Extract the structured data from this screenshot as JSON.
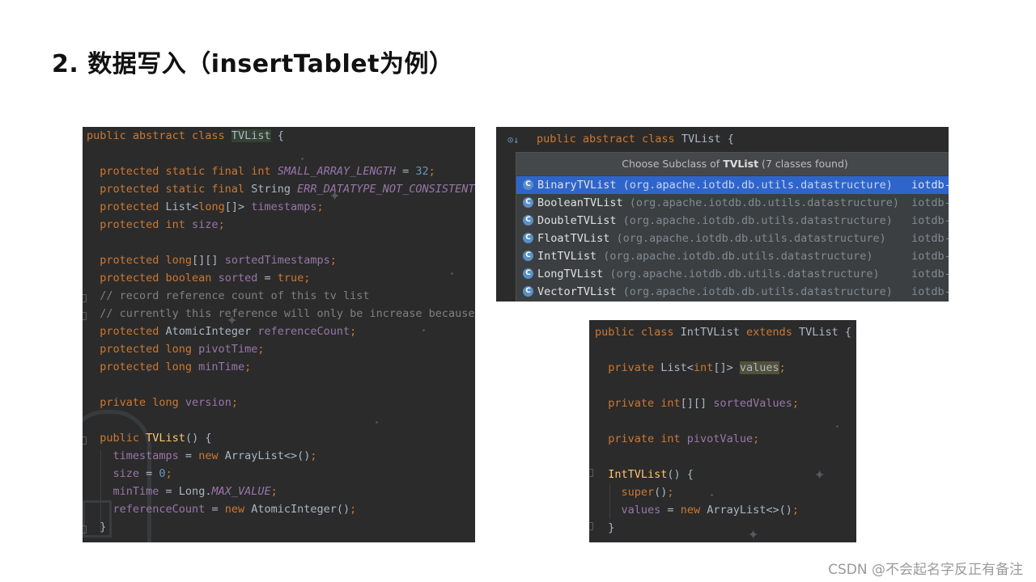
{
  "slide": {
    "title": "2. 数据写入（insertTablet为例）",
    "watermark": "CSDN @不会起名字反正有备注"
  },
  "panel_tvlist": {
    "lines": [
      [
        [
          "kw",
          "public abstract class "
        ],
        [
          "hl-class",
          "TVList"
        ],
        [
          "plain",
          " {"
        ]
      ],
      [],
      [
        [
          "kw",
          "  protected static final int "
        ],
        [
          "sfld",
          "SMALL_ARRAY_LENGTH"
        ],
        [
          "plain",
          " = "
        ],
        [
          "num",
          "32"
        ],
        [
          "kw",
          ";"
        ]
      ],
      [
        [
          "kw",
          "  protected static final "
        ],
        [
          "plain",
          "String "
        ],
        [
          "sfld",
          "ERR_DATATYPE_NOT_CONSISTENT"
        ]
      ],
      [
        [
          "kw",
          "  protected "
        ],
        [
          "plain",
          "List<"
        ],
        [
          "kw",
          "long"
        ],
        [
          "plain",
          "[]> "
        ],
        [
          "fld",
          "timestamps"
        ],
        [
          "kw",
          ";"
        ]
      ],
      [
        [
          "kw",
          "  protected int "
        ],
        [
          "fld",
          "size"
        ],
        [
          "kw",
          ";"
        ]
      ],
      [],
      [
        [
          "kw",
          "  protected long"
        ],
        [
          "plain",
          "[][] "
        ],
        [
          "fld",
          "sortedTimestamps"
        ],
        [
          "kw",
          ";"
        ]
      ],
      [
        [
          "kw",
          "  protected boolean "
        ],
        [
          "fld",
          "sorted"
        ],
        [
          "plain",
          " = "
        ],
        [
          "kw",
          "true;"
        ]
      ],
      [
        [
          "cmt",
          "  // record reference count of this tv list"
        ]
      ],
      [
        [
          "cmt",
          "  // currently this reference will only be increase because"
        ]
      ],
      [
        [
          "kw",
          "  protected "
        ],
        [
          "plain",
          "AtomicInteger "
        ],
        [
          "fld",
          "referenceCount"
        ],
        [
          "kw",
          ";"
        ]
      ],
      [
        [
          "kw",
          "  protected long "
        ],
        [
          "fld",
          "pivotTime"
        ],
        [
          "kw",
          ";"
        ]
      ],
      [
        [
          "kw",
          "  protected long "
        ],
        [
          "fld",
          "minTime"
        ],
        [
          "kw",
          ";"
        ]
      ],
      [],
      [
        [
          "kw",
          "  private long "
        ],
        [
          "fld",
          "version"
        ],
        [
          "kw",
          ";"
        ]
      ],
      [],
      [
        [
          "kw",
          "  public "
        ],
        [
          "fn",
          "TVList"
        ],
        [
          "plain",
          "() {"
        ]
      ],
      [
        [
          "plain",
          "    "
        ],
        [
          "fld",
          "timestamps"
        ],
        [
          "plain",
          " = "
        ],
        [
          "kw",
          "new "
        ],
        [
          "plain",
          "ArrayList<>()"
        ],
        [
          "kw",
          ";"
        ]
      ],
      [
        [
          "plain",
          "    "
        ],
        [
          "fld",
          "size"
        ],
        [
          "plain",
          " = "
        ],
        [
          "num",
          "0"
        ],
        [
          "kw",
          ";"
        ]
      ],
      [
        [
          "plain",
          "    "
        ],
        [
          "fld",
          "minTime"
        ],
        [
          "plain",
          " = Long."
        ],
        [
          "sfld",
          "MAX_VALUE"
        ],
        [
          "kw",
          ";"
        ]
      ],
      [
        [
          "plain",
          "    "
        ],
        [
          "fld",
          "referenceCount"
        ],
        [
          "plain",
          " = "
        ],
        [
          "kw",
          "new "
        ],
        [
          "plain",
          "AtomicInteger()"
        ],
        [
          "kw",
          ";"
        ]
      ],
      [
        [
          "plain",
          "  }"
        ]
      ]
    ]
  },
  "panel_subclass": {
    "header_line": [
      [
        "kw",
        "public abstract class "
      ],
      [
        "plain",
        "TVList {"
      ]
    ],
    "popup_title_prefix": "Choose Subclass of ",
    "popup_title_class": "TVList",
    "popup_title_suffix": " (7 classes found)",
    "icon_letter": "C",
    "items": [
      {
        "name": "BinaryTVList",
        "package": " (org.apache.iotdb.db.utils.datastructure)",
        "module": "iotdb-",
        "selected": true
      },
      {
        "name": "BooleanTVList",
        "package": " (org.apache.iotdb.db.utils.datastructure)",
        "module": "iotdb-",
        "selected": false
      },
      {
        "name": "DoubleTVList",
        "package": " (org.apache.iotdb.db.utils.datastructure)",
        "module": "iotdb-",
        "selected": false
      },
      {
        "name": "FloatTVList",
        "package": " (org.apache.iotdb.db.utils.datastructure)",
        "module": "iotdb-",
        "selected": false
      },
      {
        "name": "IntTVList",
        "package": " (org.apache.iotdb.db.utils.datastructure)",
        "module": "iotdb-",
        "selected": false
      },
      {
        "name": "LongTVList",
        "package": " (org.apache.iotdb.db.utils.datastructure)",
        "module": "iotdb-",
        "selected": false
      },
      {
        "name": "VectorTVList",
        "package": " (org.apache.iotdb.db.utils.datastructure)",
        "module": "iotdb-",
        "selected": false
      }
    ]
  },
  "panel_inttvlist": {
    "lines": [
      [
        [
          "kw",
          "public class "
        ],
        [
          "plain",
          "IntTVList "
        ],
        [
          "kw",
          "extends "
        ],
        [
          "plain",
          "TVList {"
        ]
      ],
      [],
      [
        [
          "kw",
          "  private "
        ],
        [
          "plain",
          "List<"
        ],
        [
          "kw",
          "int"
        ],
        [
          "plain",
          "[]> "
        ],
        [
          "hl-val",
          "values"
        ],
        [
          "kw",
          ";"
        ]
      ],
      [],
      [
        [
          "kw",
          "  private int"
        ],
        [
          "plain",
          "[][] "
        ],
        [
          "fld",
          "sortedValues"
        ],
        [
          "kw",
          ";"
        ]
      ],
      [],
      [
        [
          "kw",
          "  private int "
        ],
        [
          "fld",
          "pivotValue"
        ],
        [
          "kw",
          ";"
        ]
      ],
      [],
      [
        [
          "plain",
          "  "
        ],
        [
          "fn",
          "IntTVList"
        ],
        [
          "plain",
          "() {"
        ]
      ],
      [
        [
          "plain",
          "    "
        ],
        [
          "kw",
          "super"
        ],
        [
          "plain",
          "()"
        ],
        [
          "kw",
          ";"
        ]
      ],
      [
        [
          "plain",
          "    "
        ],
        [
          "fld",
          "values"
        ],
        [
          "plain",
          " = "
        ],
        [
          "kw",
          "new "
        ],
        [
          "plain",
          "ArrayList<>()"
        ],
        [
          "kw",
          ";"
        ]
      ],
      [
        [
          "plain",
          "  }"
        ]
      ]
    ]
  },
  "colors": {
    "editor_bg": "#2b2b2b",
    "keyword": "#cc7832",
    "field": "#9876aa",
    "number": "#6897bb",
    "comment": "#808080",
    "method": "#ffc66d",
    "selection": "#2f65ca"
  }
}
